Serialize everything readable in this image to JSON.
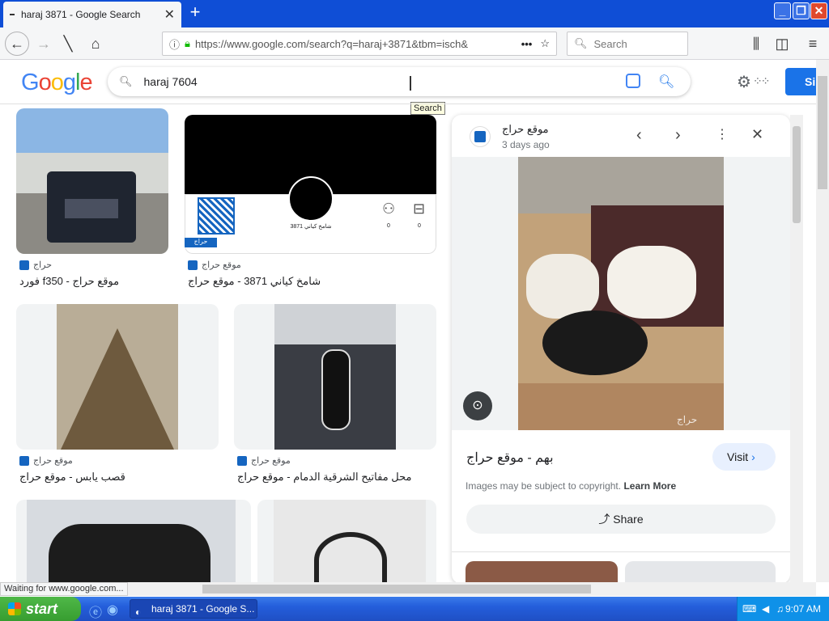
{
  "browser": {
    "tab_title": "haraj 3871 - Google Search",
    "url": "https://www.google.com/search?q=haraj+3871&tbm=isch&",
    "search_placeholder": "Search"
  },
  "google": {
    "logo": "Google",
    "query": "haraj 7604",
    "tooltip": "Search",
    "signin": "Si",
    "accent": "#1a73e8"
  },
  "results": [
    {
      "source": "حراج",
      "caption": "فورد f350 - موقع حراج"
    },
    {
      "source": "موقع حراج",
      "caption": "شامخ كياني 3871 - موقع حراج",
      "thumb_name": "شامخ كياني 3871",
      "thumb_logo": "حراج",
      "thumb_counts": [
        "0",
        "0"
      ]
    },
    {
      "source": "موقع حراج",
      "caption": "قصب يابس - موقع حراج"
    },
    {
      "source": "موقع حراج",
      "caption": "محل مفاتيح الشرقية الدمام - موقع حراج"
    }
  ],
  "panel": {
    "site": "موقع حراج",
    "time": "3 days ago",
    "title": "بهم - موقع حراج",
    "visit": "Visit",
    "copyright": "Images may be subject to copyright.",
    "learn_more": "Learn More",
    "share": "Share",
    "watermark": "حراج"
  },
  "status": "Waiting for www.google.com...",
  "taskbar": {
    "start": "start",
    "task": "haraj 3871 - Google S...",
    "clock": "9:07 AM"
  }
}
